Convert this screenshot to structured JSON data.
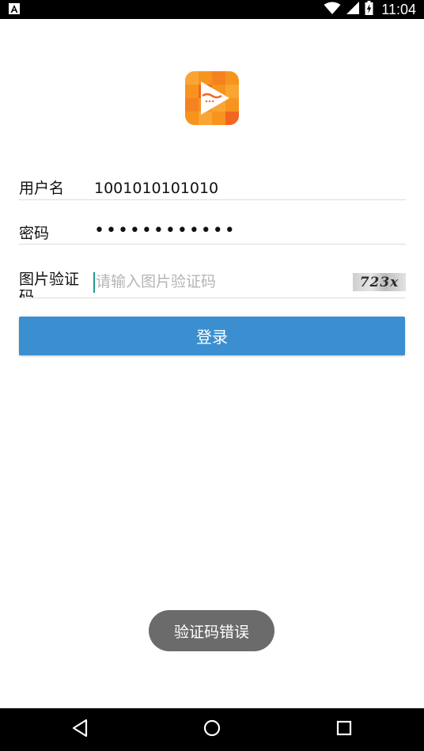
{
  "status_bar": {
    "time": "11:04",
    "icons": [
      "app-notification-icon",
      "wifi-icon",
      "signal-icon",
      "battery-icon"
    ]
  },
  "app": {
    "logo_icon": "video-play-logo-icon",
    "logo_colors": [
      "#f7941d",
      "#f26522",
      "#ffffff"
    ]
  },
  "form": {
    "username_label": "用户名",
    "username_value": "1001010101010",
    "password_label": "密码",
    "password_value": "••••••••••••",
    "captcha_label": "图片验证码",
    "captcha_placeholder": "请输入图片验证码",
    "captcha_image_text": "723x"
  },
  "login_button_label": "登录",
  "toast_message": "验证码错误",
  "colors": {
    "button": "#3b8fd0",
    "cursor": "#1a9e8f",
    "toast": "#6b6b6b"
  },
  "nav_bar": {
    "icons": [
      "back-icon",
      "home-icon",
      "recent-apps-icon"
    ]
  }
}
